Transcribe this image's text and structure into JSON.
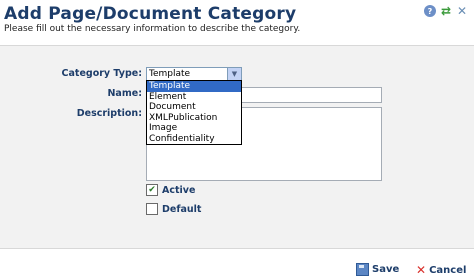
{
  "header": {
    "title": "Add Page/Document Category",
    "subtitle": "Please fill out the necessary information to describe the category.",
    "icons": {
      "help": "?",
      "refresh": "⇄",
      "close": "✕"
    }
  },
  "form": {
    "category_type_label": "Category Type:",
    "category_type_value": "Template",
    "category_type_options": [
      "Template",
      "Element",
      "Document",
      "XMLPublication",
      "Image",
      "Confidentiality"
    ],
    "name_label": "Name:",
    "description_label": "Description:",
    "active_label": "Active",
    "active_checked": true,
    "default_label": "Default",
    "default_checked": false
  },
  "footer": {
    "save_label": "Save",
    "cancel_label": "Cancel"
  },
  "colors": {
    "label": "#1d3d6a",
    "panel": "#f2f2f2",
    "selected_option": "#316ac5",
    "cancel_icon": "#d9302b"
  }
}
